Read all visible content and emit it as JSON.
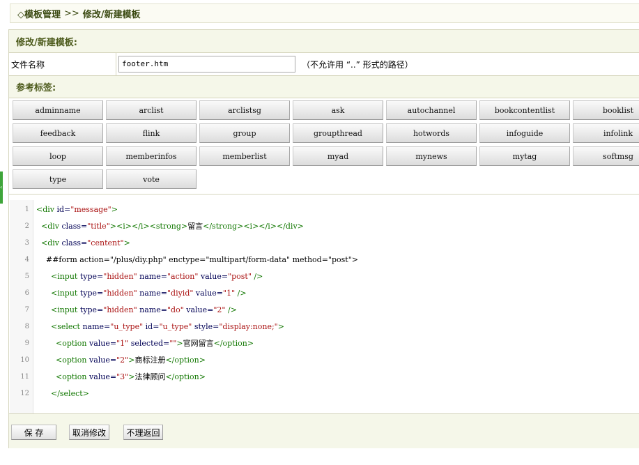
{
  "breadcrumb": {
    "root": "◇模板管理",
    "separator": ">>",
    "current": "修改/新建模板"
  },
  "panel": {
    "title": "修改/新建模板:"
  },
  "file": {
    "label": "文件名称",
    "value": "footer.htm",
    "hint": "（不允许用 “..” 形式的路径）"
  },
  "ref_tags": {
    "title": "参考标签:",
    "rows": [
      [
        "adminname",
        "arclist",
        "arclistsg",
        "ask",
        "autochannel",
        "bookcontentlist",
        "booklist"
      ],
      [
        "feedback",
        "flink",
        "group",
        "groupthread",
        "hotwords",
        "infoguide",
        "infolink"
      ],
      [
        "loop",
        "memberinfos",
        "memberlist",
        "myad",
        "mynews",
        "mytag",
        "softmsg"
      ],
      [
        "type",
        "vote"
      ]
    ]
  },
  "code_lines": [
    {
      "n": "1",
      "segs": [
        [
          "tg",
          "<div "
        ],
        [
          "at",
          "id="
        ],
        [
          "st",
          "\"message\""
        ],
        [
          "tg",
          ">"
        ]
      ]
    },
    {
      "n": "2",
      "segs": [
        [
          "tx",
          "  "
        ],
        [
          "tg",
          "<div "
        ],
        [
          "at",
          "class="
        ],
        [
          "st",
          "\"title\""
        ],
        [
          "tg",
          ">"
        ],
        [
          "tg",
          "<i>"
        ],
        [
          "tg",
          "</i>"
        ],
        [
          "tg",
          "<strong>"
        ],
        [
          "tx",
          "留言"
        ],
        [
          "tg",
          "</strong>"
        ],
        [
          "tg",
          "<i>"
        ],
        [
          "tg",
          "</i>"
        ],
        [
          "tg",
          "</div>"
        ]
      ]
    },
    {
      "n": "3",
      "segs": [
        [
          "tx",
          "  "
        ],
        [
          "tg",
          "<div "
        ],
        [
          "at",
          "class="
        ],
        [
          "st",
          "\"centent\""
        ],
        [
          "tg",
          ">"
        ]
      ]
    },
    {
      "n": "4",
      "segs": [
        [
          "tx",
          "    ##form action=\"/plus/diy.php\" enctype=\"multipart/form-data\" method=\"post\">"
        ]
      ]
    },
    {
      "n": "5",
      "segs": [
        [
          "tx",
          "      "
        ],
        [
          "tg",
          "<input "
        ],
        [
          "at",
          "type="
        ],
        [
          "st",
          "\"hidden\""
        ],
        [
          "at",
          " name="
        ],
        [
          "st",
          "\"action\""
        ],
        [
          "at",
          " value="
        ],
        [
          "st",
          "\"post\""
        ],
        [
          "tg",
          " />"
        ]
      ]
    },
    {
      "n": "6",
      "segs": [
        [
          "tx",
          "      "
        ],
        [
          "tg",
          "<input "
        ],
        [
          "at",
          "type="
        ],
        [
          "st",
          "\"hidden\""
        ],
        [
          "at",
          " name="
        ],
        [
          "st",
          "\"diyid\""
        ],
        [
          "at",
          " value="
        ],
        [
          "st",
          "\"1\""
        ],
        [
          "tg",
          " />"
        ]
      ]
    },
    {
      "n": "7",
      "segs": [
        [
          "tx",
          "      "
        ],
        [
          "tg",
          "<input "
        ],
        [
          "at",
          "type="
        ],
        [
          "st",
          "\"hidden\""
        ],
        [
          "at",
          " name="
        ],
        [
          "st",
          "\"do\""
        ],
        [
          "at",
          " value="
        ],
        [
          "st",
          "\"2\""
        ],
        [
          "tg",
          " />"
        ]
      ]
    },
    {
      "n": "8",
      "segs": [
        [
          "tx",
          "      "
        ],
        [
          "tg",
          "<select "
        ],
        [
          "at",
          "name="
        ],
        [
          "st",
          "\"u_type\""
        ],
        [
          "at",
          " id="
        ],
        [
          "st",
          "\"u_type\""
        ],
        [
          "at",
          " style="
        ],
        [
          "st",
          "\"display:none;\""
        ],
        [
          "tg",
          ">"
        ]
      ]
    },
    {
      "n": "9",
      "segs": [
        [
          "tx",
          "        "
        ],
        [
          "tg",
          "<option "
        ],
        [
          "at",
          "value="
        ],
        [
          "st",
          "\"1\""
        ],
        [
          "at",
          " selected="
        ],
        [
          "st",
          "\"\""
        ],
        [
          "tg",
          ">"
        ],
        [
          "tx",
          "官网留言"
        ],
        [
          "tg",
          "</option>"
        ]
      ]
    },
    {
      "n": "10",
      "segs": [
        [
          "tx",
          "        "
        ],
        [
          "tg",
          "<option "
        ],
        [
          "at",
          "value="
        ],
        [
          "st",
          "\"2\""
        ],
        [
          "tg",
          ">"
        ],
        [
          "tx",
          "商标注册"
        ],
        [
          "tg",
          "</option>"
        ]
      ]
    },
    {
      "n": "11",
      "segs": [
        [
          "tx",
          "        "
        ],
        [
          "tg",
          "<option "
        ],
        [
          "at",
          "value="
        ],
        [
          "st",
          "\"3\""
        ],
        [
          "tg",
          ">"
        ],
        [
          "tx",
          "法律顾问"
        ],
        [
          "tg",
          "</option>"
        ]
      ]
    },
    {
      "n": "12",
      "segs": [
        [
          "tx",
          "      "
        ],
        [
          "tg",
          "</select>"
        ]
      ]
    }
  ],
  "actions": {
    "save": "保 存",
    "cancel": "取消修改",
    "back": "不理返回"
  },
  "colors": {
    "header_bg": "#f5f7e9",
    "header_text": "#4d5b1c",
    "side_tab": "#3fa53a",
    "code_tag": "#117700",
    "code_string": "#aa1111"
  }
}
